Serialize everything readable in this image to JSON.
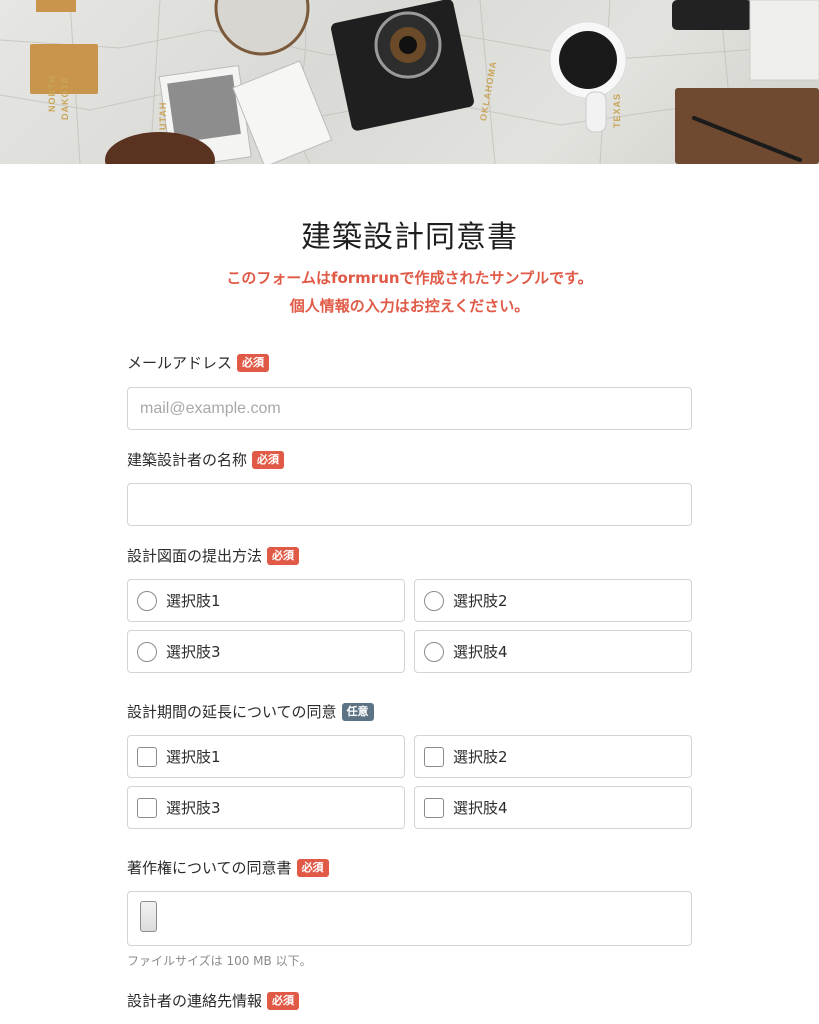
{
  "hero": {
    "map_labels": [
      "NORTH",
      "DAKOTA",
      "OKLAHOMA",
      "TEXAS",
      "UTAH"
    ]
  },
  "form": {
    "title": "建築設計同意書",
    "notice_line1": "このフォームはformrunで作成されたサンプルです。",
    "notice_line2": "個人情報の入力はお控えください。"
  },
  "badges": {
    "required": "必須",
    "optional": "任意"
  },
  "email": {
    "label": "メールアドレス",
    "placeholder": "mail@example.com",
    "value": ""
  },
  "designer_name": {
    "label": "建築設計者の名称",
    "value": ""
  },
  "submission_method": {
    "label": "設計図面の提出方法",
    "options": [
      "選択肢1",
      "選択肢2",
      "選択肢3",
      "選択肢4"
    ]
  },
  "extension_consent": {
    "label": "設計期間の延長についての同意",
    "options": [
      "選択肢1",
      "選択肢2",
      "選択肢3",
      "選択肢4"
    ]
  },
  "copyright": {
    "label": "著作権についての同意書",
    "hint": "ファイルサイズは 100 MB 以下。"
  },
  "contact": {
    "label": "設計者の連絡先情報"
  },
  "colors": {
    "accent_red": "#e05a47",
    "optional_badge": "#5c7385",
    "border": "#d4d4d4"
  }
}
